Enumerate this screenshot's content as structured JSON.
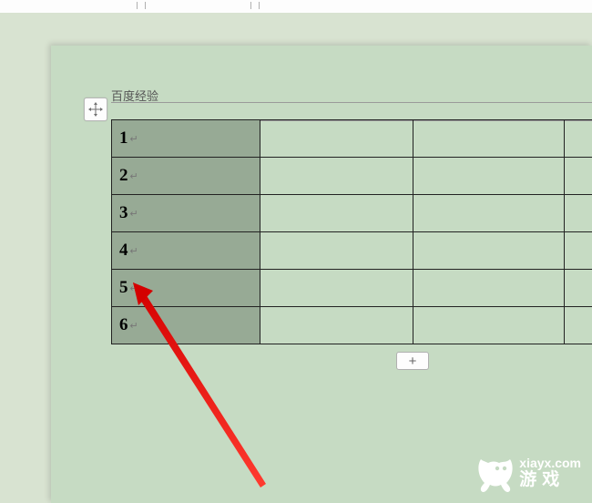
{
  "title_label": "百度经验",
  "table": {
    "rows": [
      {
        "num": "1"
      },
      {
        "num": "2"
      },
      {
        "num": "3"
      },
      {
        "num": "4"
      },
      {
        "num": "5"
      },
      {
        "num": "6"
      }
    ]
  },
  "para_mark": "↵",
  "add_button_label": "+",
  "watermark": {
    "url": "xiayx.com",
    "cn": "游戏"
  }
}
